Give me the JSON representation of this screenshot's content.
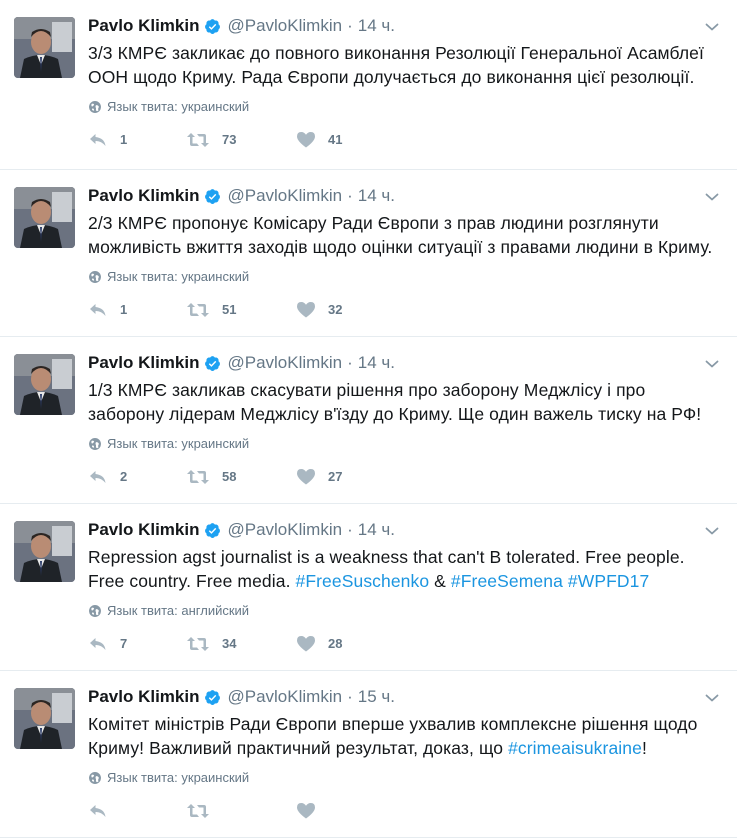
{
  "tweets": [
    {
      "name": "Pavlo Klimkin",
      "handle": "@PavloKlimkin",
      "sep": "·",
      "time": "14 ч.",
      "text": [
        {
          "t": "3/3 КМРЄ закликає до повного виконання Резолюції Генеральної Асамблеї ООН щодо Криму. Рада Європи долучається до виконання цієї резолюції."
        }
      ],
      "lang": "Язык твита: украинский",
      "replies": "1",
      "retweets": "73",
      "likes": "41"
    },
    {
      "name": "Pavlo Klimkin",
      "handle": "@PavloKlimkin",
      "sep": "·",
      "time": "14 ч.",
      "text": [
        {
          "t": "2/3 КМРЄ пропонує Комісару Ради Європи з прав людини розглянути можливість вжиття заходів щодо оцінки ситуації з правами людини в Криму."
        }
      ],
      "lang": "Язык твита: украинский",
      "replies": "1",
      "retweets": "51",
      "likes": "32"
    },
    {
      "name": "Pavlo Klimkin",
      "handle": "@PavloKlimkin",
      "sep": "·",
      "time": "14 ч.",
      "text": [
        {
          "t": "1/3 КМРЄ закликав скасувати рішення про заборону Меджлісу і про заборону лідерам Меджлісу в'їзду до Криму. Ще один важель тиску на РФ!"
        }
      ],
      "lang": "Язык твита: украинский",
      "replies": "2",
      "retweets": "58",
      "likes": "27"
    },
    {
      "name": "Pavlo Klimkin",
      "handle": "@PavloKlimkin",
      "sep": "·",
      "time": "14 ч.",
      "text": [
        {
          "t": "Repression agst journalist is a weakness that can't B tolerated. Free people. Free country. Free media. "
        },
        {
          "t": "#FreeSuschenko",
          "link": true
        },
        {
          "t": " & "
        },
        {
          "t": "#FreeSemena",
          "link": true
        },
        {
          "t": " "
        },
        {
          "t": "#WPFD17",
          "link": true
        }
      ],
      "lang": "Язык твита: английский",
      "replies": "7",
      "retweets": "34",
      "likes": "28"
    },
    {
      "name": "Pavlo Klimkin",
      "handle": "@PavloKlimkin",
      "sep": "·",
      "time": "15 ч.",
      "text": [
        {
          "t": "Комітет міністрів Ради Європи вперше ухвалив комплексне рішення щодо Криму! Важливий практичний результат, доказ, що "
        },
        {
          "t": "#crimeaisukraine",
          "link": true
        },
        {
          "t": "!"
        }
      ],
      "lang": "Язык твита: украинский",
      "replies": "",
      "retweets": "",
      "likes": ""
    }
  ],
  "colors": {
    "accent": "#1b95e0",
    "muted": "#657786",
    "text": "#14171a",
    "divider": "#e6ecf0"
  },
  "icons": {
    "verified": "verified-badge-icon",
    "caret": "chevron-down-icon",
    "globe": "globe-icon",
    "reply": "reply-icon",
    "retweet": "retweet-icon",
    "like": "heart-icon"
  }
}
